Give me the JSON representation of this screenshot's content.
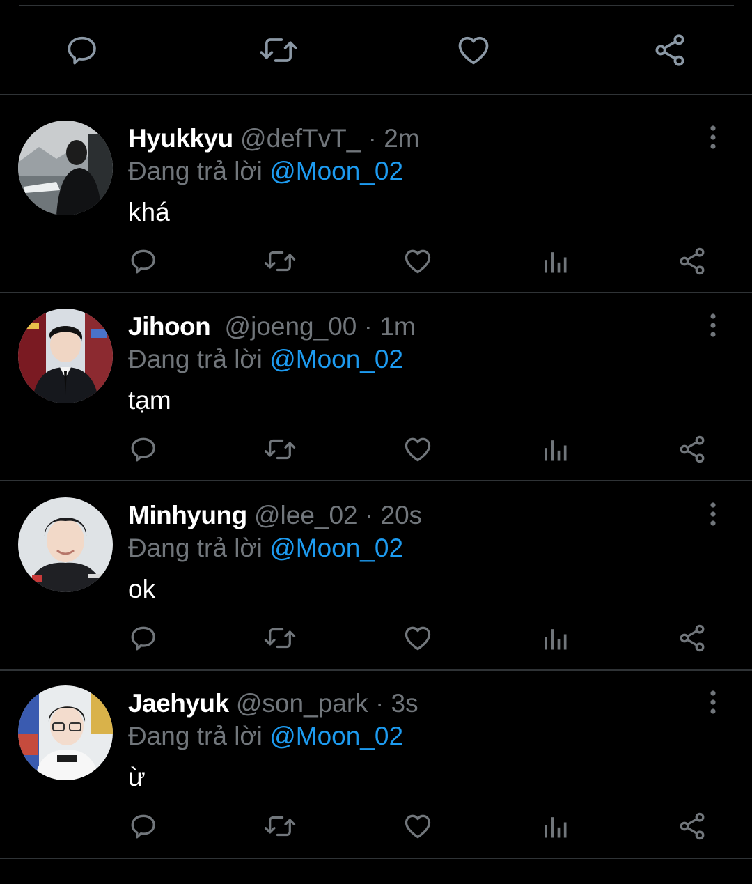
{
  "main_tweet_actions": {
    "icons": [
      "reply-icon",
      "retweet-icon",
      "like-icon",
      "share-icon"
    ]
  },
  "replies": [
    {
      "display_name": "Hyukkyu",
      "handle": "@defTvT_",
      "separator": "·",
      "time": "2m",
      "replying_prefix": "Đang trả lời",
      "replying_to": "@Moon_02",
      "text": "khá"
    },
    {
      "display_name": "Jihoon",
      "handle": "@joeng_00",
      "separator": "·",
      "time": "1m",
      "replying_prefix": "Đang trả lời",
      "replying_to": "@Moon_02",
      "text": "tạm"
    },
    {
      "display_name": "Minhyung",
      "handle": "@lee_02",
      "separator": "·",
      "time": "20s",
      "replying_prefix": "Đang trả lời",
      "replying_to": "@Moon_02",
      "text": "ok"
    },
    {
      "display_name": "Jaehyuk",
      "handle": "@son_park",
      "separator": "·",
      "time": "3s",
      "replying_prefix": "Đang trả lời",
      "replying_to": "@Moon_02",
      "text": "ừ"
    }
  ],
  "colors": {
    "background": "#000000",
    "divider": "#2f3336",
    "secondary_text": "#71767b",
    "link": "#1d9bf0",
    "primary_text": "#ffffff"
  }
}
